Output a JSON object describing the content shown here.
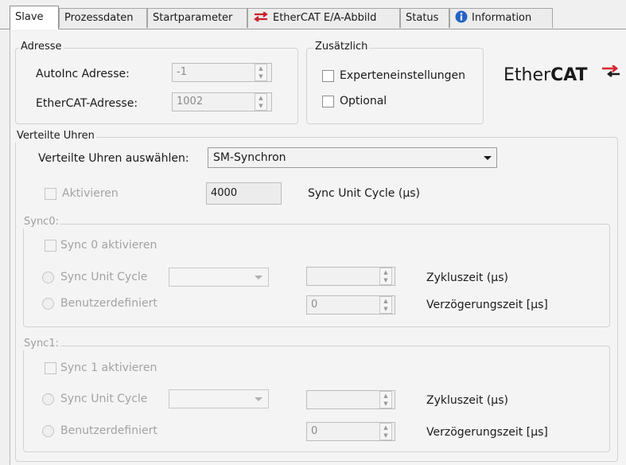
{
  "tabs": [
    {
      "label": "Slave",
      "icon": ""
    },
    {
      "label": "Prozessdaten",
      "icon": ""
    },
    {
      "label": "Startparameter",
      "icon": ""
    },
    {
      "label": "EtherCAT E/A-Abbild",
      "icon": "ethercat-arrows-icon"
    },
    {
      "label": "Status",
      "icon": ""
    },
    {
      "label": "Information",
      "icon": "info-icon"
    }
  ],
  "active_tab": "Slave",
  "adresse": {
    "title": "Adresse",
    "autoinc_label": "AutoInc Adresse:",
    "autoinc_value": "-1",
    "ethercat_label": "EtherCAT-Adresse:",
    "ethercat_value": "1002"
  },
  "zusaetzlich": {
    "title": "Zusätzlich",
    "experten_label": "Experteneinstellungen",
    "optional_label": "Optional"
  },
  "logo": {
    "part1": "Ether",
    "part2": "CAT",
    "accent": "#d8262e"
  },
  "verteilte_uhren": {
    "title": "Verteilte Uhren",
    "select_label": "Verteilte Uhren auswählen:",
    "select_value": "SM-Synchron",
    "aktivieren_label": "Aktivieren",
    "cycle_value": "4000",
    "cycle_label": "Sync Unit Cycle (µs)"
  },
  "sync0": {
    "title": "Sync0:",
    "aktivieren_label": "Sync 0 aktivieren",
    "sync_unit_cycle_label": "Sync Unit Cycle",
    "benutzer_label": "Benutzerdefiniert",
    "zyklus_value": "",
    "zyklus_label": "Zykluszeit (µs)",
    "verzoegerung_value": "0",
    "verzoegerung_label": "Verzögerungszeit [µs]"
  },
  "sync1": {
    "title": "Sync1:",
    "aktivieren_label": "Sync 1 aktivieren",
    "sync_unit_cycle_label": "Sync Unit Cycle",
    "benutzer_label": "Benutzerdefiniert",
    "zyklus_value": "",
    "zyklus_label": "Zykluszeit (µs)",
    "verzoegerung_value": "0",
    "verzoegerung_label": "Verzögerungszeit [µs]"
  }
}
